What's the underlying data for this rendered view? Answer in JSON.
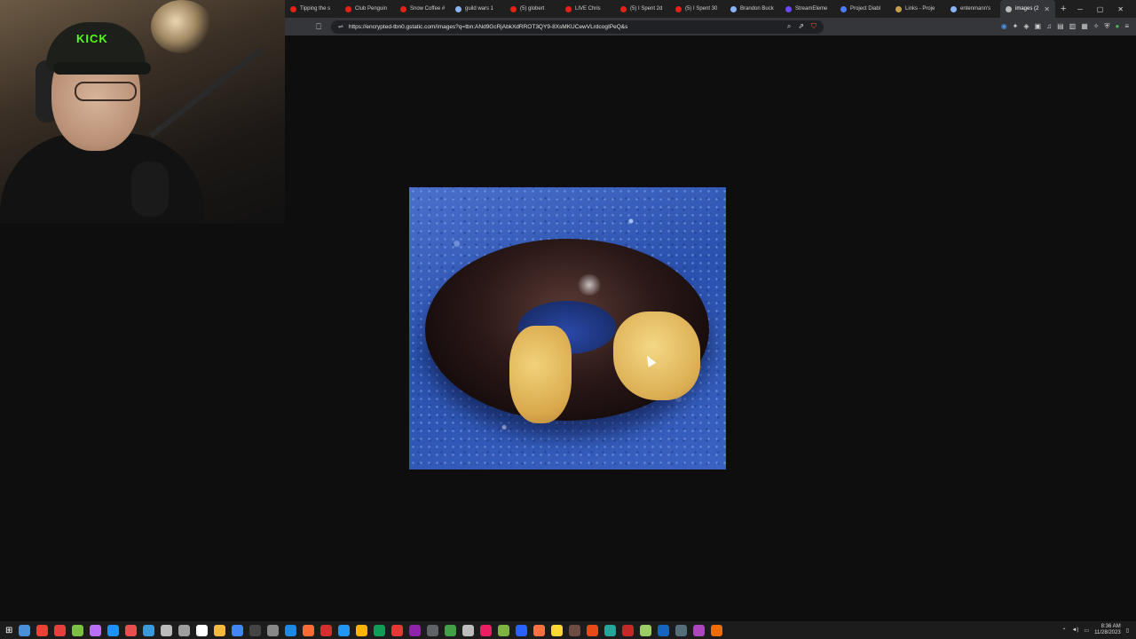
{
  "browser": {
    "tabs": [
      {
        "label": "Tipping the s",
        "favicon_color": "#e62117"
      },
      {
        "label": "Club Penguin",
        "favicon_color": "#e62117"
      },
      {
        "label": "Snow Coffee #",
        "favicon_color": "#e62117"
      },
      {
        "label": "guild wars 1",
        "favicon_color": "#8ab4f8"
      },
      {
        "label": "(5) globert",
        "favicon_color": "#e62117"
      },
      {
        "label": "LIVE Chris",
        "favicon_color": "#e62117"
      },
      {
        "label": "(5) I Spent 2d",
        "favicon_color": "#e62117"
      },
      {
        "label": "(5) I Spent 30",
        "favicon_color": "#e62117"
      },
      {
        "label": "Brandon Buck",
        "favicon_color": "#8ab4f8"
      },
      {
        "label": "StreamEleme",
        "favicon_color": "#6c47ff"
      },
      {
        "label": "Project Diabl",
        "favicon_color": "#4a7cff"
      },
      {
        "label": "Links - Proje",
        "favicon_color": "#c8a04a"
      },
      {
        "label": "entenmann's",
        "favicon_color": "#8ab4f8"
      },
      {
        "label": "images (2",
        "favicon_color": "#bbbbbb",
        "active": true
      }
    ],
    "new_tab_label": "+",
    "url": "https://encrypted-tbn0.gstatic.com/images?q=tbn:ANd9GcRjAbkXdRROT3QY9-8XsMKUCewVLrdcogIPeQ&s"
  },
  "overlay": {
    "cap_logo": "KICK"
  },
  "colors": {
    "page_bg": "#0e0e0e",
    "tab_bar": "#1f1f1f",
    "toolbar": "#35363a",
    "brave_shield": "#fb542b"
  },
  "taskbar": {
    "time": "8:36 AM",
    "date": "11/28/2023",
    "icons": [
      "#4a90d9",
      "#ea4335",
      "#e83e3e",
      "#7bc043",
      "#b86ef5",
      "#1e90ff",
      "#e84e4e",
      "#3a9ad9",
      "#bbbbbb",
      "#9e9e9e",
      "#ffffff",
      "#f5b942",
      "#4285f4",
      "#444444",
      "#888888",
      "#1e88e5",
      "#ff6b35",
      "#d32f2f",
      "#2196f3",
      "#ffb300",
      "#0f9d58",
      "#e53935",
      "#8e24aa",
      "#5f6368",
      "#43a047",
      "#bdbdbd",
      "#e91e63",
      "#7cb342",
      "#2962ff",
      "#ff7043",
      "#fdd835",
      "#6d4c41",
      "#e64a19",
      "#26a69a",
      "#c62828",
      "#9ccc65",
      "#1565c0",
      "#546e7a",
      "#ab47bc",
      "#ef6c00"
    ]
  }
}
